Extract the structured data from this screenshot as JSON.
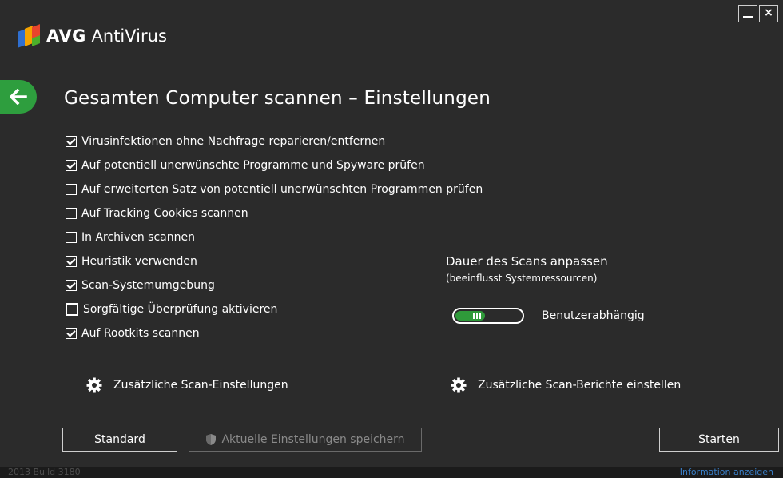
{
  "window": {
    "minimize_icon": "minimize-icon",
    "close_label": "×",
    "close_icon": "close-icon"
  },
  "logo": {
    "brand": "AVG",
    "product": "AntiVirus",
    "colors": [
      "#2f6fd0",
      "#f5a300",
      "#e8452c",
      "#4caf2a"
    ]
  },
  "back_button": {
    "icon": "back-arrow-icon",
    "color": "#2e9e3e"
  },
  "page_title": "Gesamten Computer scannen – Einstellungen",
  "options": [
    {
      "label": "Virusinfektionen ohne Nachfrage reparieren/entfernen",
      "checked": true
    },
    {
      "label": "Auf potentiell unerwünschte Programme und Spyware prüfen",
      "checked": true
    },
    {
      "label": "Auf erweiterten Satz von potentiell unerwünschten Programmen prüfen",
      "checked": false
    },
    {
      "label": "Auf Tracking Cookies scannen",
      "checked": false
    },
    {
      "label": "In Archiven scannen",
      "checked": false
    },
    {
      "label": "Heuristik verwenden",
      "checked": true
    },
    {
      "label": "Scan-Systemumgebung",
      "checked": true
    },
    {
      "label": "Sorgfältige Überprüfung aktivieren",
      "checked": false
    },
    {
      "label": "Auf Rootkits scannen",
      "checked": true
    }
  ],
  "duration": {
    "title": "Dauer des Scans anpassen",
    "subtitle": "(beeinflusst Systemressourcen)",
    "value_label": "Benutzerabhängig",
    "slider_fraction": 0.45,
    "accent": "#2f9a3a"
  },
  "extra": {
    "settings_label": "Zusätzliche Scan-Einstellungen",
    "reports_label": "Zusätzliche Scan-Berichte einstellen",
    "icon": "gear-icon"
  },
  "buttons": {
    "standard": "Standard",
    "save": "Aktuelle Einstellungen speichern",
    "save_icon": "shield-icon",
    "start": "Starten"
  },
  "status": {
    "version": "2013  Build 3180",
    "info_link": "Information anzeigen"
  }
}
